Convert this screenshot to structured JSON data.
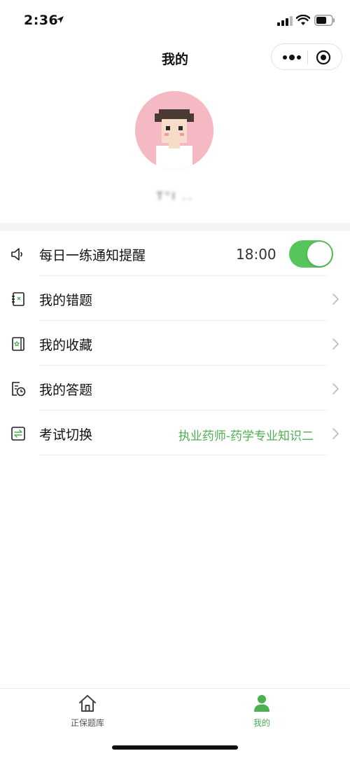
{
  "status_bar": {
    "time": "2:36"
  },
  "nav": {
    "title": "我的"
  },
  "profile": {
    "username": "T\"I .."
  },
  "settings": {
    "reminder": {
      "label": "每日一练通知提醒",
      "time": "18:00",
      "enabled": true
    },
    "rows": [
      {
        "label": "我的错题",
        "icon": "notebook-icon"
      },
      {
        "label": "我的收藏",
        "icon": "star-book-icon"
      },
      {
        "label": "我的答题",
        "icon": "history-icon"
      },
      {
        "label": "考试切换",
        "icon": "switch-icon",
        "value": "执业药师-药学专业知识二"
      }
    ]
  },
  "tab_bar": {
    "tabs": [
      {
        "label": "正保题库",
        "icon": "home-icon",
        "active": false
      },
      {
        "label": "我的",
        "icon": "person-icon",
        "active": true
      }
    ]
  },
  "colors": {
    "accent": "#4caf50",
    "toggle_on": "#56c55b",
    "avatar_bg": "#f4b9c2"
  }
}
